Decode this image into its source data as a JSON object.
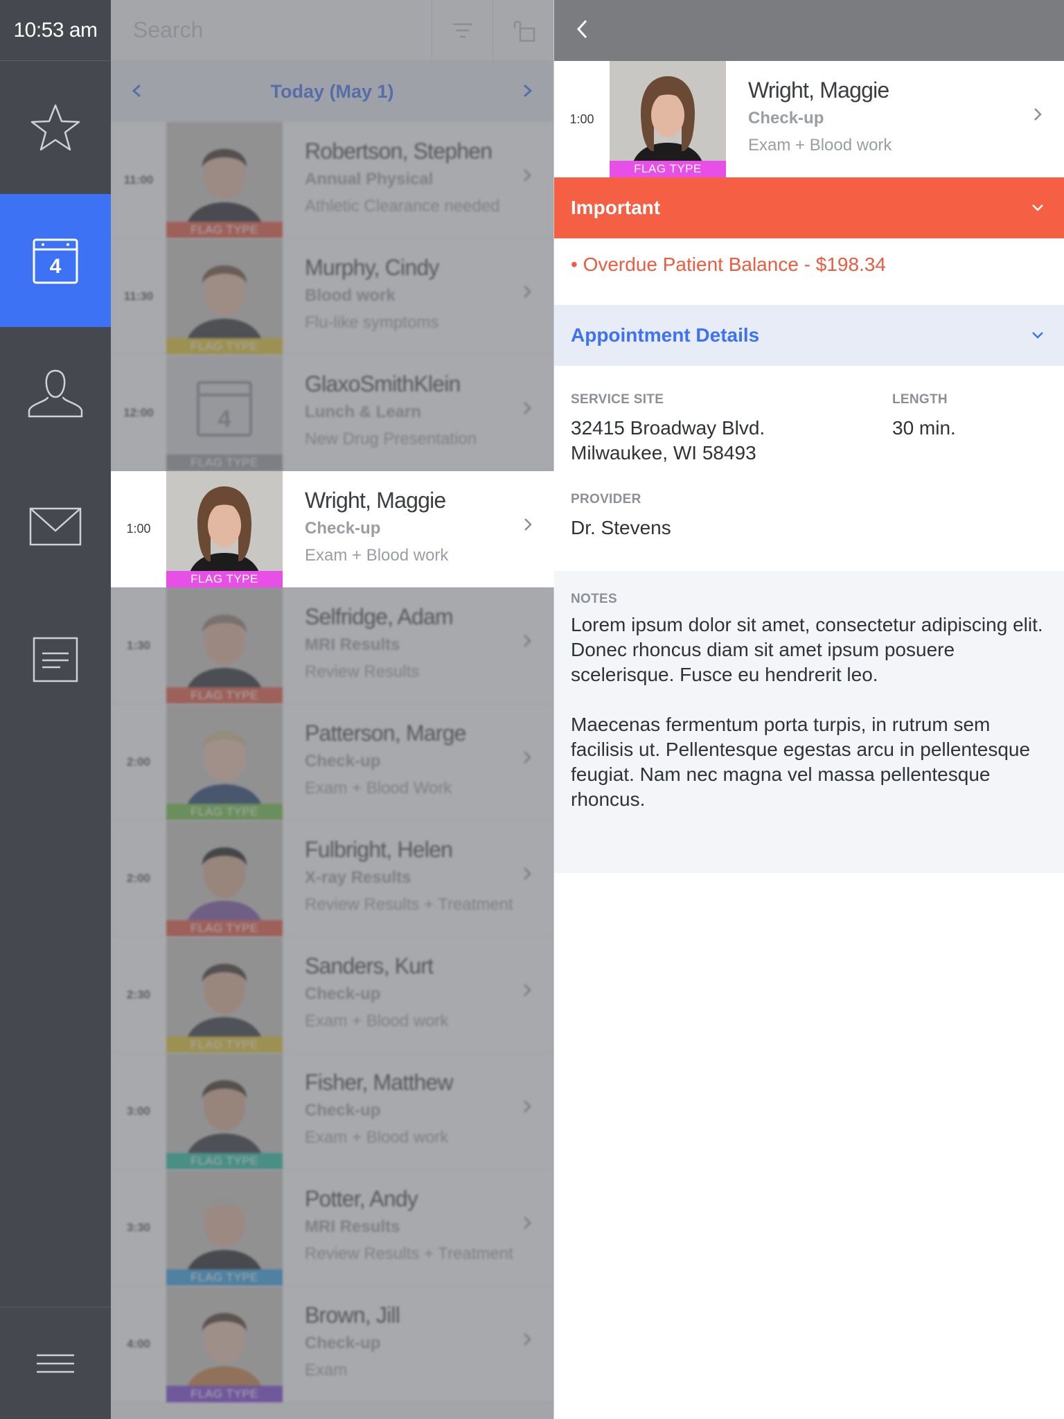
{
  "status": {
    "time": "10:53 am"
  },
  "search": {
    "placeholder": "Search"
  },
  "datebar": {
    "label": "Today (May 1)"
  },
  "calendar_badge": "4",
  "colors": {
    "accent": "#3d72f5",
    "important": "#f55f44",
    "flag_pink": "#e84fe6",
    "flag_red": "#e7543c",
    "flag_yellow": "#e5c52a",
    "flag_gray": "#9a9ca1",
    "flag_green": "#6cc142",
    "flag_teal": "#1fc0a5",
    "flag_blue": "#2b9fe2",
    "flag_purple": "#7a3fd8"
  },
  "icons": {
    "rail": [
      "star-icon",
      "calendar-icon",
      "person-icon",
      "mail-icon",
      "document-icon",
      "menu-icon"
    ],
    "search": [
      "filter-icon",
      "lock-icon"
    ],
    "nav": [
      "chevron-left-icon",
      "chevron-right-icon",
      "chevron-down-icon"
    ]
  },
  "appointments": [
    {
      "time": "11:00",
      "name": "Robertson, Stephen",
      "type": "Annual Physical",
      "desc": "Athletic Clearance needed",
      "flag": "FLAG TYPE",
      "flag_color": "#e7543c"
    },
    {
      "time": "11:30",
      "name": "Murphy, Cindy",
      "type": "Blood work",
      "desc": "Flu-like symptoms",
      "flag": "FLAG TYPE",
      "flag_color": "#e5c52a"
    },
    {
      "time": "12:00",
      "name": "GlaxoSmithKlein",
      "type": "Lunch & Learn",
      "desc": "New Drug Presentation",
      "flag": "FLAG TYPE",
      "flag_color": "#9a9ca1"
    },
    {
      "time": "1:00",
      "name": "Wright, Maggie",
      "type": "Check-up",
      "desc": "Exam + Blood work",
      "flag": "FLAG TYPE",
      "flag_color": "#e84fe6"
    },
    {
      "time": "1:30",
      "name": "Selfridge, Adam",
      "type": "MRI Results",
      "desc": "Review Results",
      "flag": "FLAG TYPE",
      "flag_color": "#e7543c"
    },
    {
      "time": "2:00",
      "name": "Patterson, Marge",
      "type": "Check-up",
      "desc": "Exam + Blood Work",
      "flag": "FLAG TYPE",
      "flag_color": "#6cc142"
    },
    {
      "time": "2:00",
      "name": "Fulbright, Helen",
      "type": "X-ray Results",
      "desc": "Review Results + Treatment",
      "flag": "FLAG TYPE",
      "flag_color": "#e7543c"
    },
    {
      "time": "2:30",
      "name": "Sanders, Kurt",
      "type": "Check-up",
      "desc": "Exam + Blood work",
      "flag": "FLAG TYPE",
      "flag_color": "#e5c52a"
    },
    {
      "time": "3:00",
      "name": "Fisher, Matthew",
      "type": "Check-up",
      "desc": "Exam + Blood work",
      "flag": "FLAG TYPE",
      "flag_color": "#1fc0a5"
    },
    {
      "time": "3:30",
      "name": "Potter, Andy",
      "type": "MRI Results",
      "desc": "Review Results + Treatment",
      "flag": "FLAG TYPE",
      "flag_color": "#2b9fe2"
    },
    {
      "time": "4:00",
      "name": "Brown, Jill",
      "type": "Check-up",
      "desc": "Exam",
      "flag": "FLAG TYPE",
      "flag_color": "#7a3fd8"
    }
  ],
  "detail": {
    "time": "1:00",
    "name": "Wright, Maggie",
    "type": "Check-up",
    "desc": "Exam + Blood work",
    "flag": "FLAG TYPE",
    "important_title": "Important",
    "important_item": "• Overdue Patient Balance - $198.34",
    "appt_title": "Appointment Details",
    "service_site_label": "SERVICE SITE",
    "service_site_line1": "32415 Broadway Blvd.",
    "service_site_line2": "Milwaukee, WI 58493",
    "length_label": "LENGTH",
    "length_value": "30 min.",
    "provider_label": "PROVIDER",
    "provider_value": "Dr. Stevens",
    "notes_label": "NOTES",
    "notes_p1": "Lorem ipsum dolor sit amet, consectetur adipiscing elit. Donec rhoncus diam sit amet ipsum posuere scelerisque. Fusce eu hendrerit leo.",
    "notes_p2": "Maecenas fermentum porta turpis, in rutrum sem facilisis ut. Pellentesque egestas arcu in pellentesque feugiat. Nam nec magna vel massa pellentesque rhoncus."
  }
}
